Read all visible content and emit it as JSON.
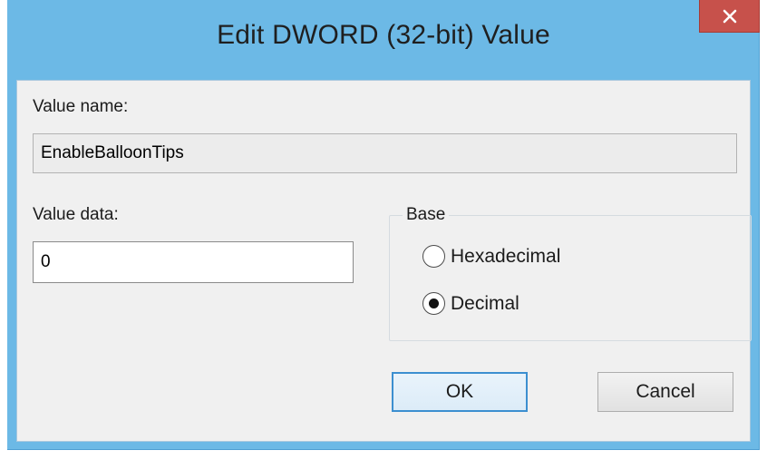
{
  "window": {
    "title": "Edit DWORD (32-bit) Value",
    "close_glyph": "×"
  },
  "value_name": {
    "label": "Value name:",
    "value": "EnableBalloonTips"
  },
  "value_data": {
    "label": "Value data:",
    "value": "0"
  },
  "base": {
    "label": "Base",
    "options": [
      {
        "label": "Hexadecimal",
        "selected": false
      },
      {
        "label": "Decimal",
        "selected": true
      }
    ]
  },
  "buttons": {
    "ok": "OK",
    "cancel": "Cancel"
  },
  "colors": {
    "frame": "#6cb9e6",
    "close_button": "#c7514b",
    "client_background": "#f0f0f0",
    "default_button_border": "#3c8fd0"
  },
  "icons": {
    "close": "close-icon",
    "radio_selected": "radio-selected-icon",
    "radio_unselected": "radio-unselected-icon"
  }
}
